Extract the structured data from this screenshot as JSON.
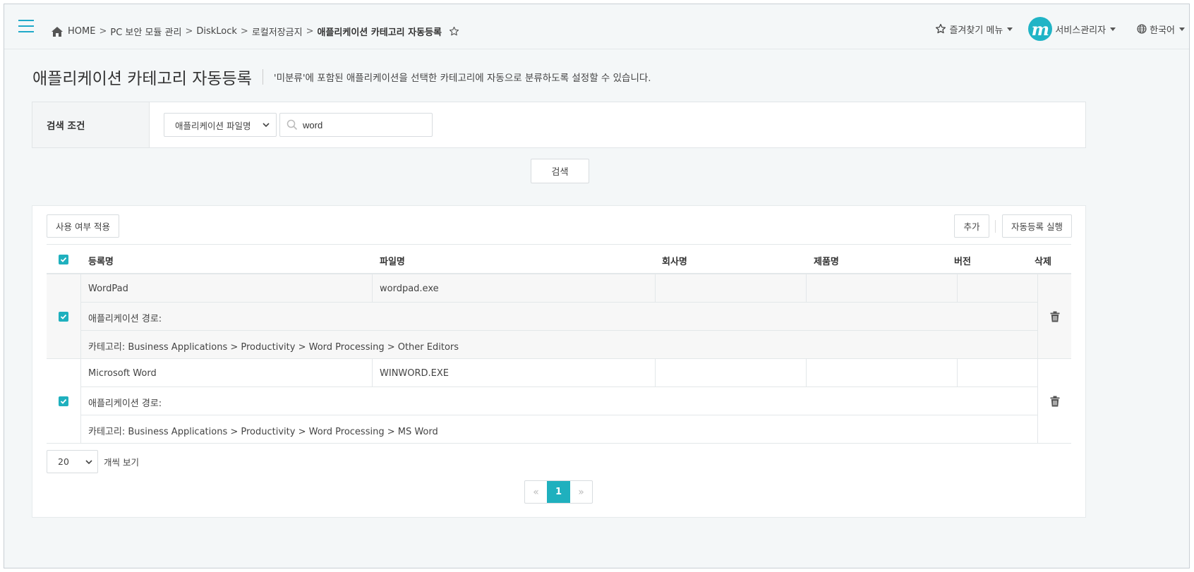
{
  "breadcrumb": {
    "items": [
      "HOME",
      "PC 보안 모듈 관리",
      "DiskLock",
      "로컬저장금지"
    ],
    "separator": ">",
    "current": "애플리케이션 카테고리 자동등록"
  },
  "topbar": {
    "favorites_label": "즐겨찾기 메뉴",
    "user_label": "서비스관리자",
    "avatar_letter": "m",
    "language_label": "한국어"
  },
  "page": {
    "title": "애플리케이션 카테고리 자동등록",
    "description": "'미분류'에 포함된 애플리케이션을 선택한 카테고리에 자동으로 분류하도록 설정할 수 있습니다."
  },
  "search": {
    "label": "검색 조건",
    "field_select": "애플리케이션 파일명",
    "query": "word",
    "button_label": "검색"
  },
  "toolbar": {
    "apply_label": "사용 여부 적용",
    "add_label": "추가",
    "run_label": "자동등록 실행"
  },
  "table": {
    "columns": {
      "name": "등록명",
      "file": "파일명",
      "company": "회사명",
      "product": "제품명",
      "version": "버전",
      "delete": "삭제"
    },
    "rows": [
      {
        "name": "WordPad",
        "file": "wordpad.exe",
        "company": "",
        "product": "",
        "version": "",
        "path": "애플리케이션 경로:",
        "category": "카테고리: Business Applications > Productivity > Word Processing > Other Editors",
        "checked": true
      },
      {
        "name": "Microsoft Word",
        "file": "WINWORD.EXE",
        "company": "",
        "product": "",
        "version": "",
        "path": "애플리케이션 경로:",
        "category": "카테고리: Business Applications > Productivity > Word Processing > MS Word",
        "checked": true
      }
    ]
  },
  "paging": {
    "page_size": "20",
    "page_size_suffix": "개씩 보기",
    "prev": "«",
    "current_page": "1",
    "next": "»"
  },
  "colors": {
    "accent": "#1fb0be",
    "hamburger": "#20a9c9"
  }
}
